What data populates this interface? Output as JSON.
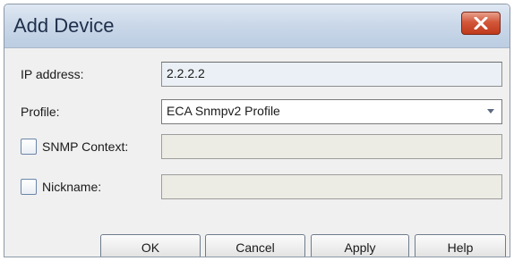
{
  "dialog": {
    "title": "Add Device",
    "close_icon": "close-icon"
  },
  "form": {
    "ip_address": {
      "label": "IP address:",
      "value": "2.2.2.2"
    },
    "profile": {
      "label": "Profile:",
      "value": "ECA Snmpv2 Profile",
      "icon": "chevron-down-icon"
    },
    "snmp_context": {
      "label": "SNMP Context:",
      "value": "",
      "checked": false
    },
    "nickname": {
      "label": "Nickname:",
      "value": "",
      "checked": false
    }
  },
  "buttons": {
    "ok": "OK",
    "cancel": "Cancel",
    "apply": "Apply",
    "help": "Help"
  },
  "colors": {
    "close_button": "#c0391b",
    "titlebar": "#c9d7e8",
    "dialog_bg": "#f0f0f0"
  }
}
